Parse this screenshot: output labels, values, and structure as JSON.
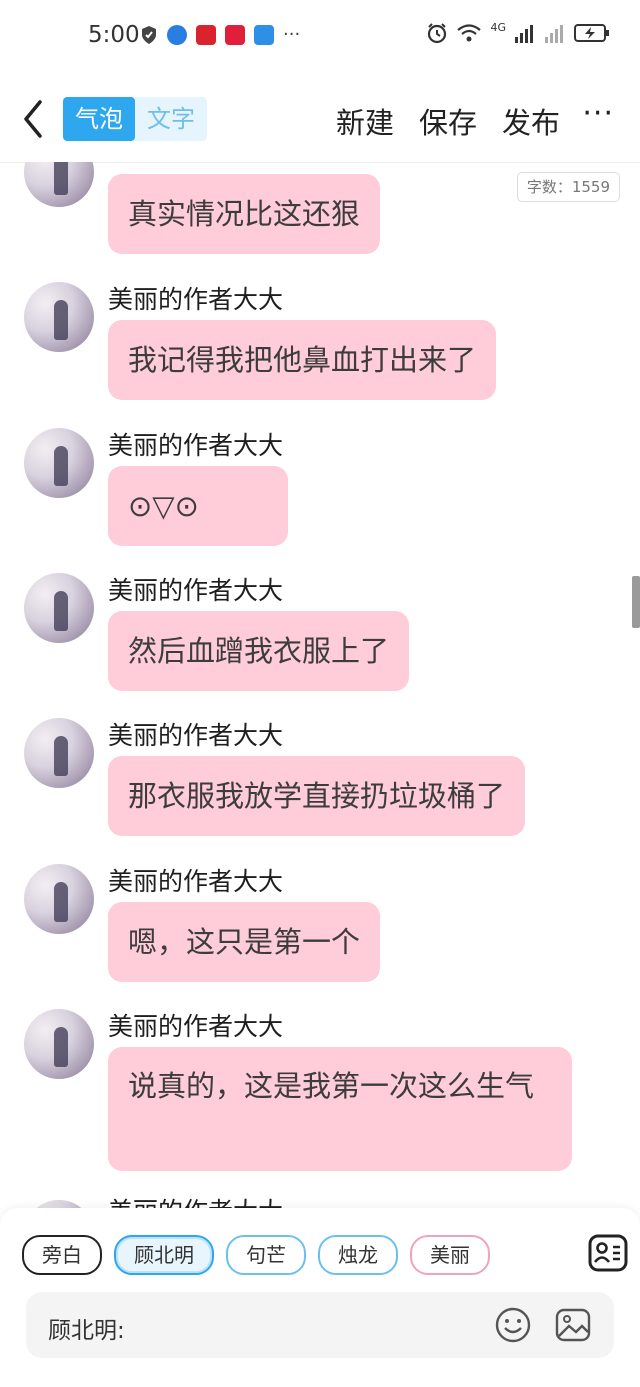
{
  "status_bar": {
    "time": "5:00",
    "network": "4G",
    "icons": [
      "shield-icon",
      "browser-icon",
      "book-app-icon",
      "heart-app-icon",
      "weather-app-icon",
      "more-dots-icon",
      "alarm-icon",
      "wifi-icon",
      "signal-icon",
      "battery-charging-icon"
    ]
  },
  "header": {
    "back_icon": "chevron-left-icon",
    "mode_tabs": [
      {
        "label": "气泡",
        "active": true
      },
      {
        "label": "文字",
        "active": false
      }
    ],
    "new_label": "新建",
    "save_label": "保存",
    "publish_label": "发布",
    "more_label": "···"
  },
  "word_count": "字数：1559",
  "messages": [
    {
      "author": "",
      "text": "真实情况比这还狠"
    },
    {
      "author": "美丽的作者大大",
      "text": "我记得我把他鼻血打出来了"
    },
    {
      "author": "美丽的作者大大",
      "text": "⊙▽⊙"
    },
    {
      "author": "美丽的作者大大",
      "text": "然后血蹭我衣服上了"
    },
    {
      "author": "美丽的作者大大",
      "text": "那衣服我放学直接扔垃圾桶了"
    },
    {
      "author": "美丽的作者大大",
      "text": "嗯，这只是第一个"
    },
    {
      "author": "美丽的作者大大",
      "text": "说真的，这是我第一次这么生气"
    },
    {
      "author": "美丽的作者大大",
      "text": ""
    }
  ],
  "characters": [
    "旁白",
    "顾北明",
    "句芒",
    "烛龙",
    "美丽"
  ],
  "input": {
    "prefix": "顾北明:",
    "emoji_icon": "smiley-icon",
    "image_icon": "image-icon",
    "roles_icon": "contact-card-icon"
  },
  "colors": {
    "bubble": "#ffccd9",
    "accent": "#2ea7ee"
  }
}
